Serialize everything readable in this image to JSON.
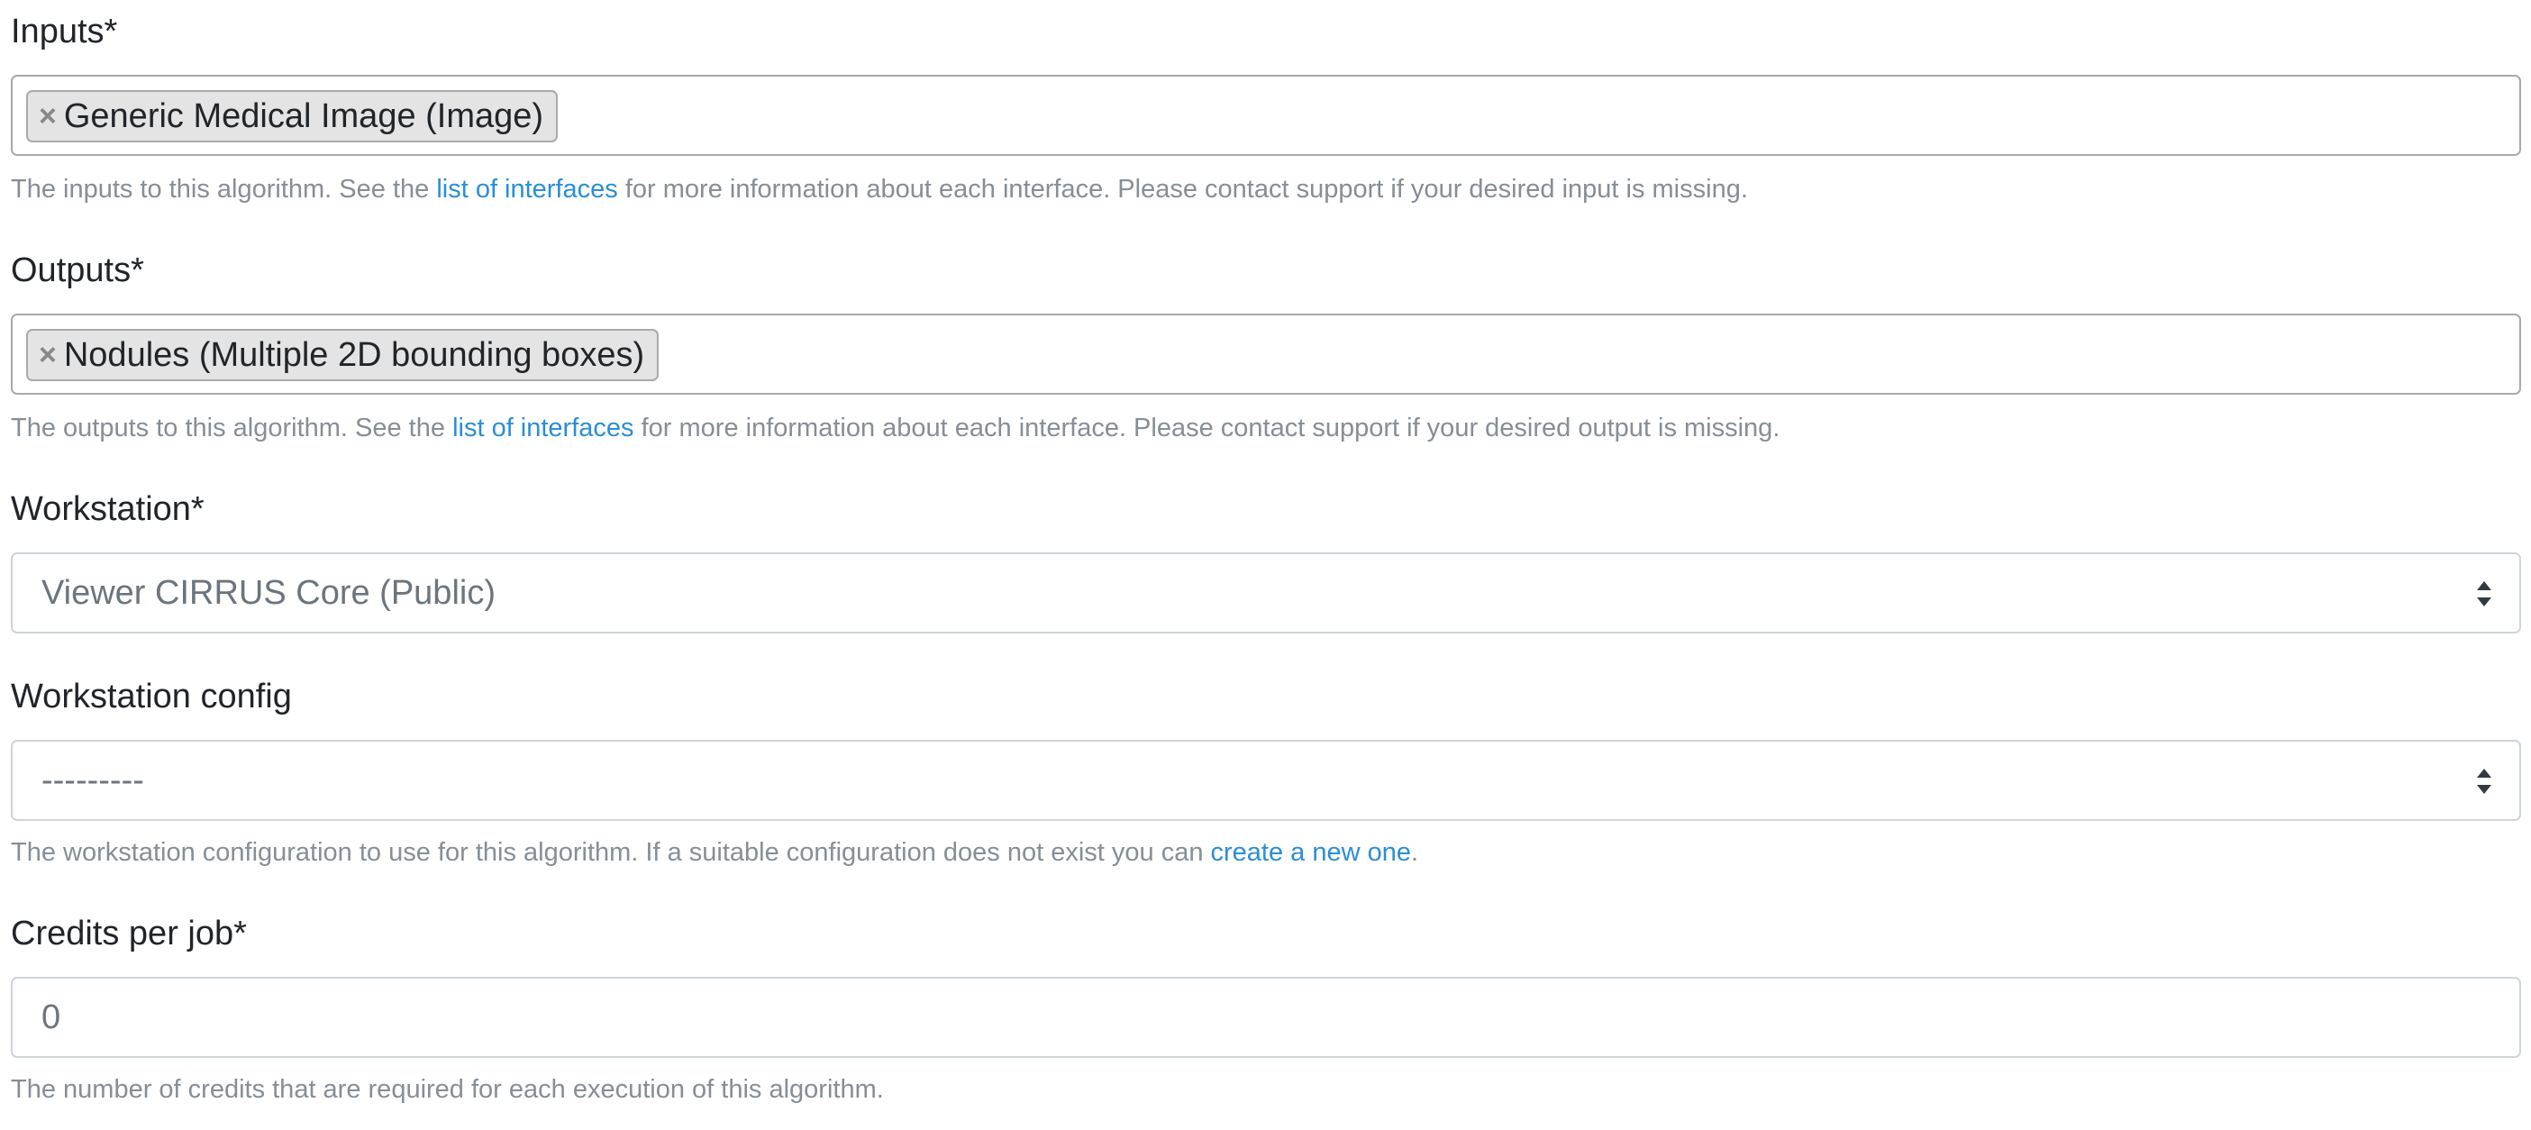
{
  "inputs": {
    "label": "Inputs*",
    "chips": [
      {
        "remove": "×",
        "text": "Generic Medical Image (Image)"
      }
    ],
    "help_before": "The inputs to this algorithm. See the ",
    "help_link": "list of interfaces",
    "help_after": " for more information about each interface. Please contact support if your desired input is missing."
  },
  "outputs": {
    "label": "Outputs*",
    "chips": [
      {
        "remove": "×",
        "text": "Nodules (Multiple 2D bounding boxes)"
      }
    ],
    "help_before": "The outputs to this algorithm. See the ",
    "help_link": "list of interfaces",
    "help_after": " for more information about each interface. Please contact support if your desired output is missing."
  },
  "workstation": {
    "label": "Workstation*",
    "selected": "Viewer CIRRUS Core (Public)"
  },
  "workstation_config": {
    "label": "Workstation config",
    "selected": "---------",
    "help_before": "The workstation configuration to use for this algorithm. If a suitable configuration does not exist you can ",
    "help_link": "create a new one",
    "help_after": "."
  },
  "credits": {
    "label": "Credits per job*",
    "value": "0",
    "help": "The number of credits that are required for each execution of this algorithm."
  },
  "colors": {
    "link": "#2a8ed6",
    "help_text": "#868e96",
    "chip_bg": "#e4e4e4"
  }
}
